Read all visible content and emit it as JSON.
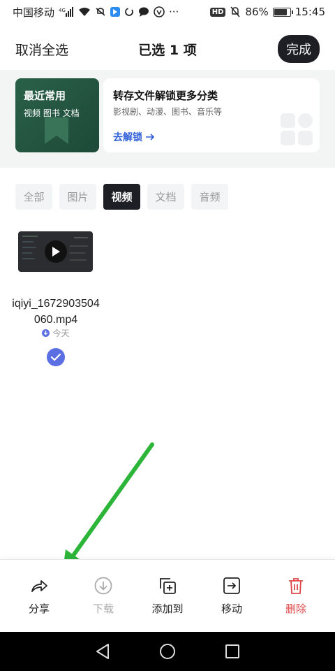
{
  "status_bar": {
    "carrier": "中国移动",
    "network_badge": "4G",
    "hd_badge": "HD",
    "battery_text": "86%",
    "battery_level": 0.86,
    "time": "15:45",
    "more": "···"
  },
  "header": {
    "cancel_label": "取消全选",
    "title": "已选 1 项",
    "done_label": "完成"
  },
  "promo": {
    "green_title": "最近常用",
    "green_sub": "视频 图书 文档",
    "card_title": "转存文件解锁更多分类",
    "card_sub": "影视剧、动漫、图书、音乐等",
    "card_link": "去解锁",
    "link_color": "#2f5fd8"
  },
  "tabs": [
    {
      "label": "全部",
      "active": false
    },
    {
      "label": "图片",
      "active": false
    },
    {
      "label": "视频",
      "active": true
    },
    {
      "label": "文档",
      "active": false
    },
    {
      "label": "音频",
      "active": false
    }
  ],
  "file": {
    "name": "iqiyi_1672903504060.mp4",
    "date": "今天",
    "selected": true
  },
  "toolbar": [
    {
      "label": "分享",
      "icon": "share-icon",
      "state": "normal"
    },
    {
      "label": "下载",
      "icon": "download-icon",
      "state": "disabled"
    },
    {
      "label": "添加到",
      "icon": "add-to-icon",
      "state": "normal"
    },
    {
      "label": "移动",
      "icon": "move-icon",
      "state": "normal"
    },
    {
      "label": "删除",
      "icon": "trash-icon",
      "state": "danger"
    }
  ],
  "colors": {
    "accent": "#5b6fe3",
    "dark": "#1e1f24",
    "danger": "#e04848",
    "annotation_arrow": "#2db53a"
  }
}
